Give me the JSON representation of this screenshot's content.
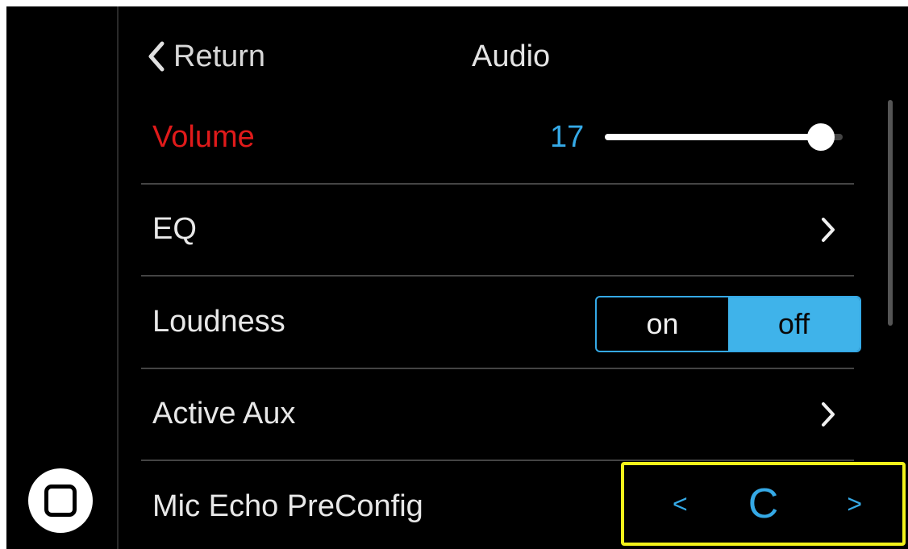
{
  "header": {
    "return_label": "Return",
    "title": "Audio"
  },
  "rows": {
    "volume": {
      "label": "Volume",
      "value": "17",
      "level": 0.91,
      "label_color": "#e01a1a",
      "value_color": "#35a9e6"
    },
    "eq": {
      "label": "EQ"
    },
    "loudness": {
      "label": "Loudness",
      "on_label": "on",
      "off_label": "off",
      "selected": "off"
    },
    "active_aux": {
      "label": "Active Aux"
    },
    "mic_echo": {
      "label": "Mic Echo PreConfig",
      "value": "C",
      "prev_symbol": "<",
      "next_symbol": ">"
    }
  },
  "icons": {
    "home": "home-button-icon",
    "back": "chevron-left-icon",
    "forward": "chevron-right-icon"
  },
  "colors": {
    "accent": "#35a9e6",
    "highlight_border": "#f3f21a",
    "background": "#000000"
  }
}
